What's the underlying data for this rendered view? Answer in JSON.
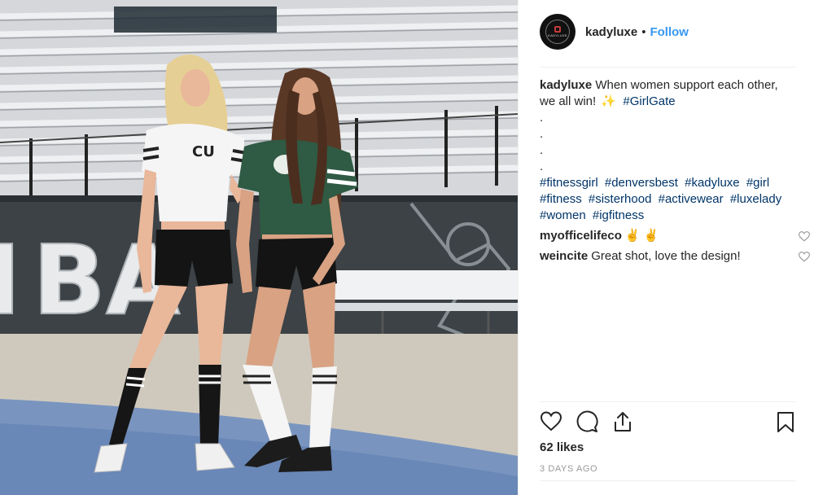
{
  "post": {
    "photo_alt": "",
    "author": {
      "username": "kadyluxe",
      "avatar_icon": "kadyluxe-logo-avatar",
      "avatar_text": "KADYLUXE",
      "follow_label": "Follow",
      "separator": "•"
    },
    "caption": {
      "author": "kadyluxe",
      "text": "When women support each other, we all win!",
      "sparkle": "✨",
      "hashtag": "#GirlGate",
      "dots": [
        ".",
        ".",
        ".",
        "."
      ],
      "hashtags": [
        "#fitnessgirl",
        "#denversbest",
        "#kadyluxe",
        "#girl",
        "#fitness",
        "#sisterhood",
        "#activewear",
        "#luxelady",
        "#women",
        "#igfitness"
      ]
    },
    "comments": [
      {
        "author": "myofficelifeco",
        "text": "✌️ ✌️"
      },
      {
        "author": "weincite",
        "text": "Great shot, love the design!"
      }
    ],
    "actions": {
      "like_icon": "heart-icon",
      "comment_icon": "comment-icon",
      "share_icon": "share-icon",
      "save_icon": "bookmark-icon"
    },
    "likes": "62 likes",
    "timestamp": "3 DAYS AGO"
  },
  "colors": {
    "link": "#3897f0",
    "hashtag": "#003569",
    "text": "#262626",
    "muted": "#999999",
    "divider": "#efefef"
  }
}
